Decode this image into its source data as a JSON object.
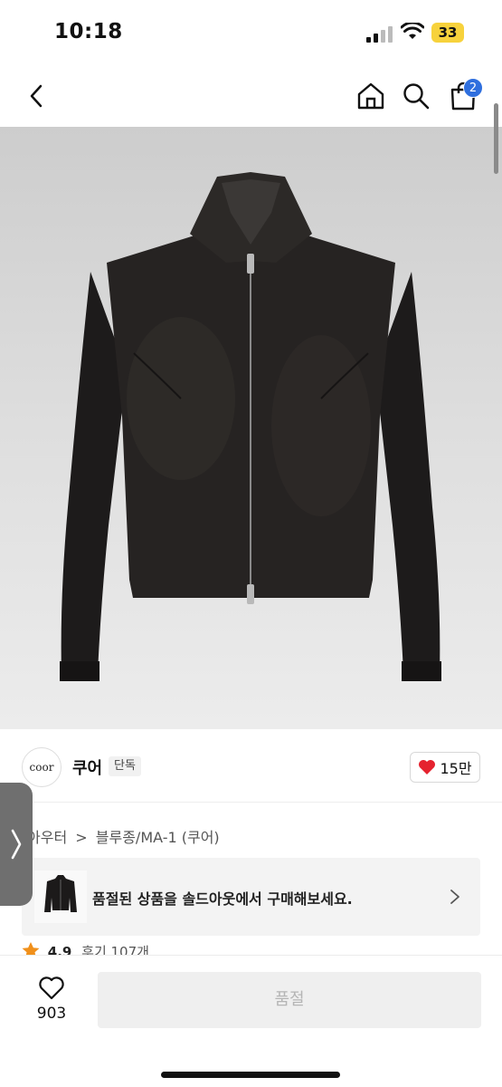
{
  "status_bar": {
    "time": "10:18",
    "battery_level": "33",
    "icons": [
      "signal-icon",
      "wifi-icon",
      "battery-icon"
    ]
  },
  "nav": {
    "icons": [
      "back-arrow-icon",
      "home-icon",
      "search-icon",
      "cart-icon"
    ],
    "cart_count": "2",
    "accent_color": "#2f6fde"
  },
  "product": {
    "image_subject": "jacket-image"
  },
  "brand": {
    "logo_text": "coor",
    "name": "쿠어",
    "tag": "단독",
    "likes": "15만",
    "like_color": "#e5222f"
  },
  "breadcrumb": {
    "items": [
      "아우터",
      "블루종/MA-1 (쿠어)"
    ],
    "separator": ">"
  },
  "soldout_banner": {
    "text": "품절된 상품을 솔드아웃에서 구매해보세요."
  },
  "rating": {
    "score": "4.9",
    "reviews": "후기 107개",
    "star_color": "#f0901b"
  },
  "bottom_bar": {
    "wish_count": "903",
    "soldout_label": "품절"
  }
}
